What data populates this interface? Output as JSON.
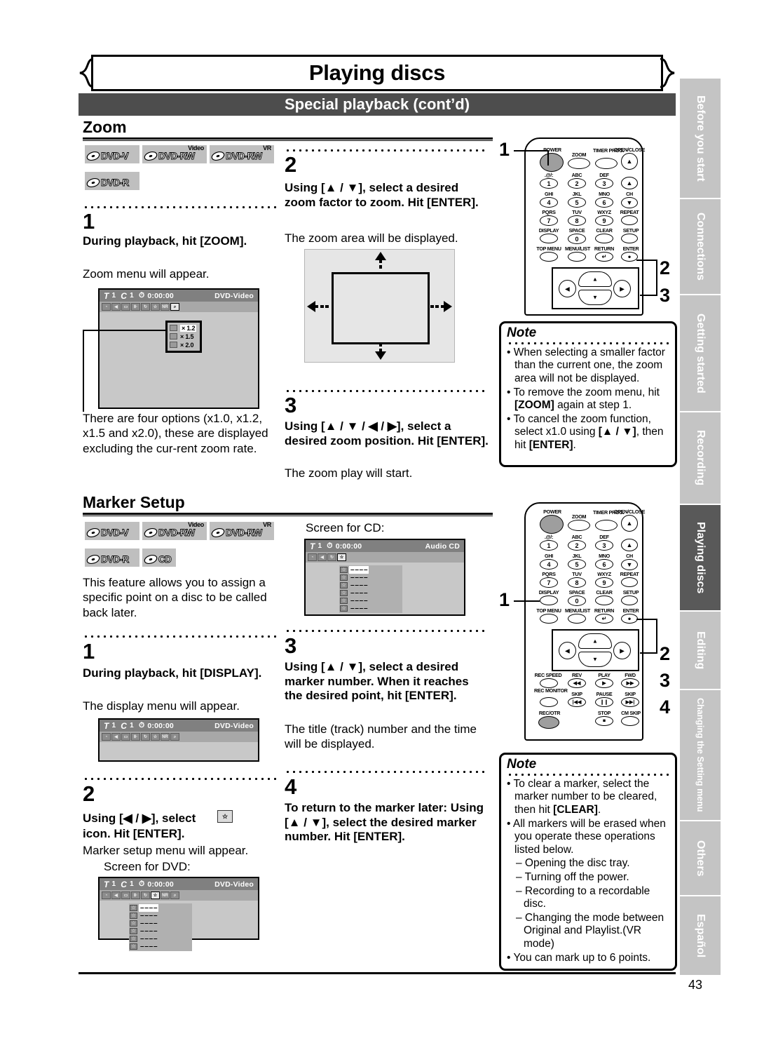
{
  "header": {
    "title": "Playing discs",
    "subtitle": "Special playback (cont’d)"
  },
  "page_number": "43",
  "sections": [
    {
      "id": "zoom",
      "title": "Zoom",
      "badges": [
        {
          "label": "DVD-V",
          "sup": ""
        },
        {
          "label": "DVD-RW",
          "sup": "Video"
        },
        {
          "label": "DVD-RW",
          "sup": "VR"
        },
        {
          "label": "DVD-R",
          "sup": ""
        }
      ],
      "steps": [
        {
          "num": "1",
          "bold": "During playback, hit [ZOOM].",
          "reg": "Zoom menu will appear.",
          "after": "There are four options (x1.0, x1.2, x1.5 and x2.0), these are displayed excluding the cur-rent zoom rate."
        },
        {
          "num": "2",
          "bold": "Using [▲ / ▼], select a desired zoom factor to zoom. Hit [ENTER].",
          "reg": "The zoom area will be displayed."
        },
        {
          "num": "3",
          "bold": "Using [▲ / ▼ / ◀ / ▶], select a desired zoom position. Hit [ENTER].",
          "reg": "The zoom play will start."
        }
      ],
      "osd": {
        "title_label": "T",
        "title_num": "1",
        "chapter_label": "C",
        "chapter_num": "1",
        "time": "0:00:00",
        "disc_type": "DVD-Video",
        "icons": [
          "angle-icon",
          "audio-icon",
          "subtitle-icon",
          "bitrate-icon",
          "repeat-icon",
          "marker-icon",
          "nr-icon",
          "zoom-icon"
        ],
        "zoom_options": [
          "× 1.2",
          "× 1.5",
          "× 2.0"
        ]
      },
      "note": {
        "title": "Note",
        "items": [
          {
            "text": "When selecting a smaller factor than the current one, the zoom area will not be displayed."
          },
          {
            "text": "To remove the zoom menu, hit [ZOOM] again at step 1.",
            "bold_parts": [
              "[ZOOM]"
            ]
          },
          {
            "text": "To cancel the zoom function, select x1.0 using [▲ / ▼], then hit [ENTER].",
            "bold_parts": [
              "[▲ / ▼]",
              "[ENTER]"
            ]
          }
        ]
      }
    },
    {
      "id": "marker-setup",
      "title": "Marker Setup",
      "badges": [
        {
          "label": "DVD-V",
          "sup": ""
        },
        {
          "label": "DVD-RW",
          "sup": "Video"
        },
        {
          "label": "DVD-RW",
          "sup": "VR"
        },
        {
          "label": "DVD-R",
          "sup": ""
        },
        {
          "label": "CD",
          "sup": ""
        }
      ],
      "intro": "This feature allows you to assign a specific point on a disc to be called back later.",
      "steps": [
        {
          "num": "1",
          "bold": "During playback, hit [DISPLAY].",
          "reg": "The display menu will appear."
        },
        {
          "num": "2",
          "bold_a": "Using [◀ / ▶], select",
          "bold_b": "icon. Hit [ENTER].",
          "reg": "Marker setup menu will appear.",
          "caption": "Screen for DVD:"
        },
        {
          "num": "3",
          "bold": "Using [▲ / ▼], select a desired marker number. When it reaches the desired point, hit [ENTER].",
          "reg": "The title (track) number and the time will be displayed."
        },
        {
          "num": "4",
          "bold": "To return to the marker later: Using [▲ / ▼], select the desired marker number. Hit [ENTER]."
        }
      ],
      "cd_caption": "Screen for CD:",
      "osd_dvd": {
        "title_label": "T",
        "title_num": "1",
        "chapter_label": "C",
        "chapter_num": "1",
        "time": "0:00:00",
        "disc_type": "DVD-Video",
        "icons": [
          "angle-icon",
          "audio-icon",
          "subtitle-icon",
          "bitrate-icon",
          "repeat-icon",
          "marker-icon",
          "nr-icon",
          "zoom-icon"
        ],
        "marker_rows": [
          "– – – –",
          "– – – –",
          "– – – –",
          "– – – –",
          "– – – –",
          "– – – –"
        ]
      },
      "osd_cd": {
        "title_label": "T",
        "title_num": "1",
        "time": "0:00:00",
        "disc_type": "Audio CD",
        "icons": [
          "angle-icon",
          "audio-icon",
          "repeat-icon",
          "marker-icon"
        ],
        "marker_rows": [
          "– – – –",
          "– – – –",
          "– – – –",
          "– – – –",
          "– – – –",
          "– – – –"
        ]
      },
      "note": {
        "title": "Note",
        "items": [
          {
            "text": "To clear a marker, select the marker number to be cleared, then hit [CLEAR].",
            "bold_parts": [
              "[CLEAR]"
            ]
          },
          {
            "text": "All markers will be erased when you operate these operations listed below."
          },
          {
            "text": "– Opening the disc tray.",
            "sub": true
          },
          {
            "text": "– Turning off the power.",
            "sub": true
          },
          {
            "text": "– Recording to a recordable disc.",
            "sub": true
          },
          {
            "text": "– Changing the mode between Original and Playlist.(VR mode)",
            "sub": true
          },
          {
            "text": "You can mark up to 6 points."
          }
        ]
      }
    }
  ],
  "remotes": [
    {
      "id": "remote-zoom",
      "callouts": [
        "1",
        "2",
        "3"
      ],
      "keys": [
        {
          "label": "POWER"
        },
        {
          "label": "ZOOM"
        },
        {
          "label": "TIMER PROG."
        },
        {
          "label": "OPEN/CLOSE"
        },
        {
          "label": ".@/:",
          "num": "1"
        },
        {
          "label": "ABC",
          "num": "2"
        },
        {
          "label": "DEF",
          "num": "3"
        },
        {
          "label": ""
        },
        {
          "label": "GHI",
          "num": "4"
        },
        {
          "label": "JKL",
          "num": "5"
        },
        {
          "label": "MNO",
          "num": "6"
        },
        {
          "label": "CH"
        },
        {
          "label": "PQRS",
          "num": "7"
        },
        {
          "label": "TUV",
          "num": "8"
        },
        {
          "label": "WXYZ",
          "num": "9"
        },
        {
          "label": "REPEAT"
        },
        {
          "label": "DISPLAY"
        },
        {
          "label": "SPACE",
          "num": "0"
        },
        {
          "label": "CLEAR"
        },
        {
          "label": "SETUP"
        },
        {
          "label": "TOP MENU"
        },
        {
          "label": "MENU/LIST"
        },
        {
          "label": "RETURN"
        },
        {
          "label": "ENTER"
        }
      ]
    },
    {
      "id": "remote-marker",
      "callouts": [
        "1",
        "2",
        "3",
        "4"
      ],
      "keys": [
        {
          "label": "POWER"
        },
        {
          "label": "ZOOM"
        },
        {
          "label": "TIMER PROG."
        },
        {
          "label": "OPEN/CLOSE"
        },
        {
          "label": ".@/:",
          "num": "1"
        },
        {
          "label": "ABC",
          "num": "2"
        },
        {
          "label": "DEF",
          "num": "3"
        },
        {
          "label": ""
        },
        {
          "label": "GHI",
          "num": "4"
        },
        {
          "label": "JKL",
          "num": "5"
        },
        {
          "label": "MNO",
          "num": "6"
        },
        {
          "label": "CH"
        },
        {
          "label": "PQRS",
          "num": "7"
        },
        {
          "label": "TUV",
          "num": "8"
        },
        {
          "label": "WXYZ",
          "num": "9"
        },
        {
          "label": "REPEAT"
        },
        {
          "label": "DISPLAY"
        },
        {
          "label": "SPACE",
          "num": "0"
        },
        {
          "label": "CLEAR"
        },
        {
          "label": "SETUP"
        },
        {
          "label": "TOP MENU"
        },
        {
          "label": "MENU/LIST"
        },
        {
          "label": "RETURN"
        },
        {
          "label": "ENTER"
        },
        {
          "label": "REC SPEED"
        },
        {
          "label": "REV"
        },
        {
          "label": "PLAY"
        },
        {
          "label": "FWD"
        },
        {
          "label": "REC MONITOR"
        },
        {
          "label": "SKIP"
        },
        {
          "label": "PAUSE"
        },
        {
          "label": "SKIP"
        },
        {
          "label": "REC/OTR"
        },
        {
          "label": "STOP"
        },
        {
          "label": "CM SKIP"
        }
      ]
    }
  ],
  "tabs": [
    {
      "label": "Before you start",
      "active": false,
      "narrow": false
    },
    {
      "label": "Connections",
      "active": false,
      "narrow": false
    },
    {
      "label": "Getting started",
      "active": false,
      "narrow": false
    },
    {
      "label": "Recording",
      "active": false,
      "narrow": false
    },
    {
      "label": "Playing discs",
      "active": true,
      "narrow": false
    },
    {
      "label": "Editing",
      "active": false,
      "narrow": false
    },
    {
      "label": "Changing the Setting menu",
      "active": false,
      "narrow": true
    },
    {
      "label": "Others",
      "active": false,
      "narrow": false
    },
    {
      "label": "Español",
      "active": false,
      "narrow": false
    }
  ]
}
